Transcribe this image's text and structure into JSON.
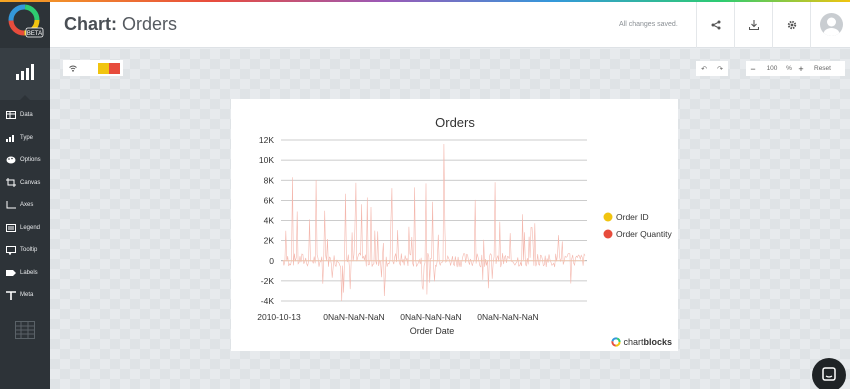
{
  "app": {
    "logo_badge": "BETA"
  },
  "header": {
    "title_prefix": "Chart:",
    "title_name": "Orders",
    "status": "All changes saved."
  },
  "sidebar": {
    "items": [
      {
        "label": "Data",
        "icon": "table-icon"
      },
      {
        "label": "Type",
        "icon": "bar-chart-icon"
      },
      {
        "label": "Options",
        "icon": "palette-icon"
      },
      {
        "label": "Canvas",
        "icon": "crop-icon"
      },
      {
        "label": "Axes",
        "icon": "axes-icon"
      },
      {
        "label": "Legend",
        "icon": "legend-icon"
      },
      {
        "label": "Tooltip",
        "icon": "tooltip-icon"
      },
      {
        "label": "Labels",
        "icon": "tag-icon"
      },
      {
        "label": "Meta",
        "icon": "text-icon"
      }
    ]
  },
  "toolbar": {
    "zoom_value": "100",
    "zoom_unit": "%",
    "reset_label": "Reset",
    "zoom_minus": "−",
    "zoom_plus": "+"
  },
  "theme": {
    "colors": [
      "#f1c40f",
      "#e74c3c"
    ]
  },
  "brand": {
    "light": "chart",
    "bold": "blocks"
  },
  "chart_data": {
    "type": "line",
    "title": "Orders",
    "xlabel": "Order Date",
    "ylabel": "",
    "ylim": [
      -4000,
      12000
    ],
    "yticks": [
      "12K",
      "10K",
      "8K",
      "6K",
      "4K",
      "2K",
      "0",
      "-2K",
      "-4K"
    ],
    "xticks": [
      "2010-10-13",
      "0NaN-NaN-NaN",
      "0NaN-NaN-NaN",
      "0NaN-NaN-NaN"
    ],
    "legend_position": "right",
    "grid": true,
    "series": [
      {
        "name": "Order ID",
        "color": "#f1c40f"
      },
      {
        "name": "Order Quantity",
        "color": "#e74c3c"
      }
    ]
  }
}
